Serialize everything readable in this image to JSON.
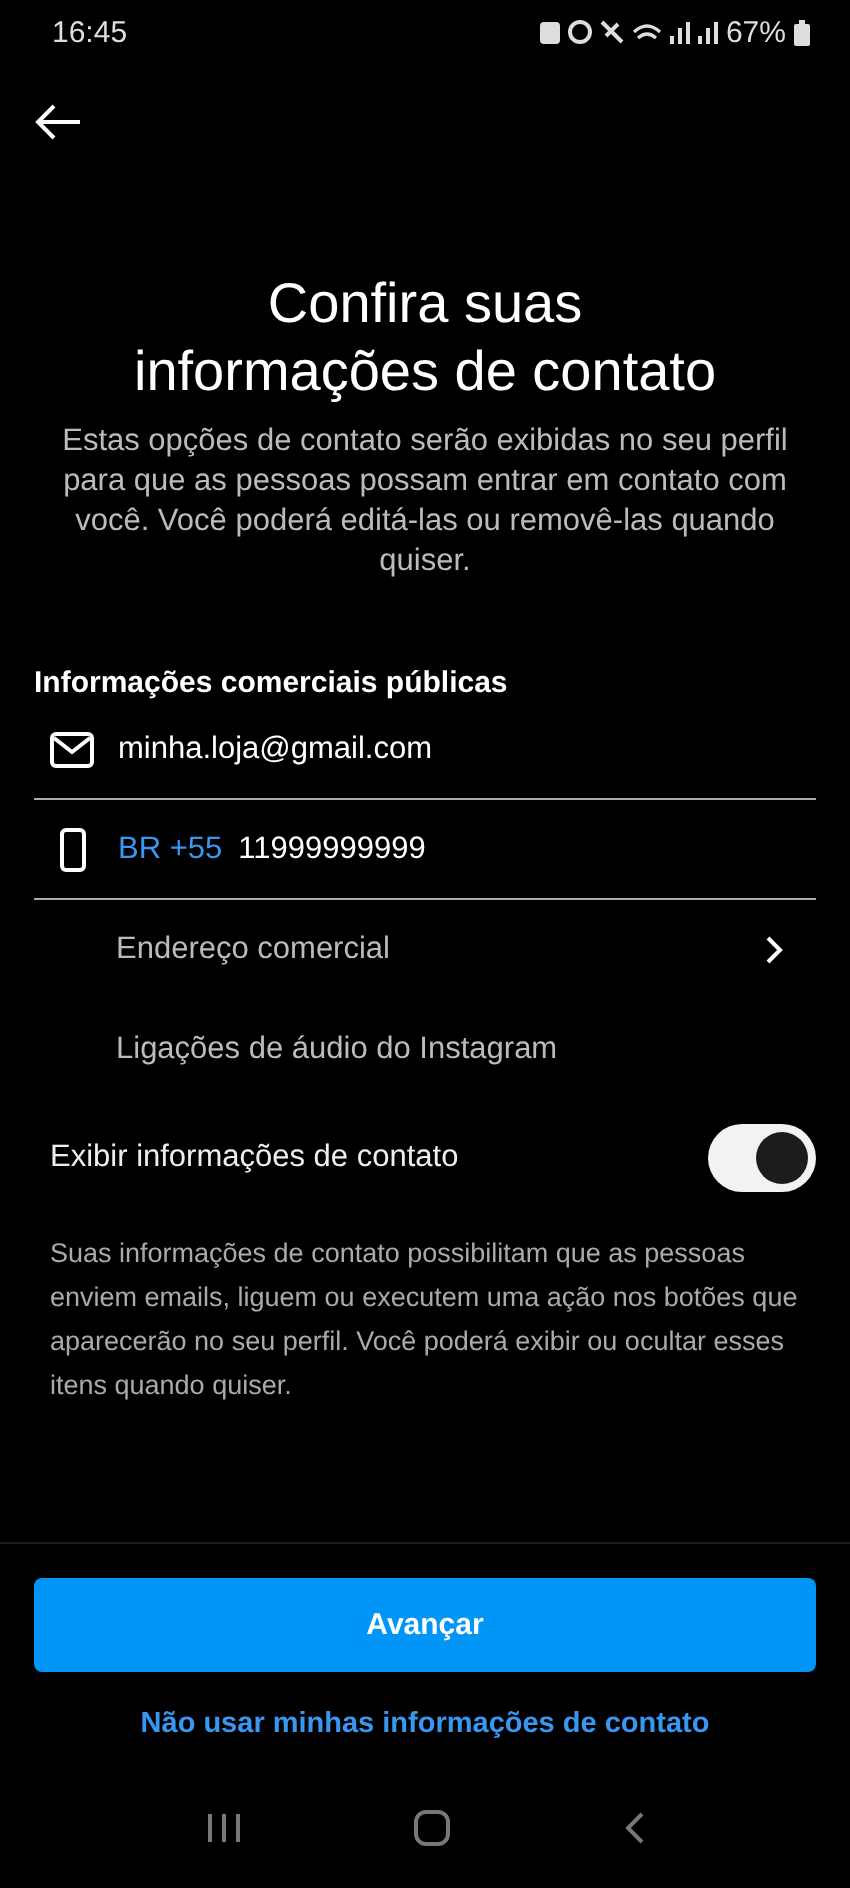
{
  "status_bar": {
    "time": "16:45",
    "battery": "67%"
  },
  "title": "Confira suas informações de contato",
  "description": "Estas opções de contato serão exibidas no seu perfil para que as pessoas possam entrar em contato com você. Você poderá editá-las ou removê-las quando quiser.",
  "section_title": "Informações comerciais públicas",
  "fields": [
    {
      "kind": "email",
      "value": "minha.loja@gmail.com"
    },
    {
      "kind": "phone",
      "prefix": "BR +55",
      "value": "11999999999"
    }
  ],
  "options": [
    {
      "kind": "link",
      "label": "Endereço comercial"
    },
    {
      "kind": "plain",
      "label": "Ligações de áudio do Instagram"
    }
  ],
  "toggle": {
    "label": "Exibir informações de contato",
    "on": true
  },
  "note": "Suas informações de contato possibilitam que as pessoas enviem emails, liguem ou executem uma ação nos botões que aparecerão no seu perfil. Você poderá exibir ou ocultar esses itens quando quiser.",
  "primary_button": "Avançar",
  "secondary_link": "Não usar minhas informações de contato"
}
